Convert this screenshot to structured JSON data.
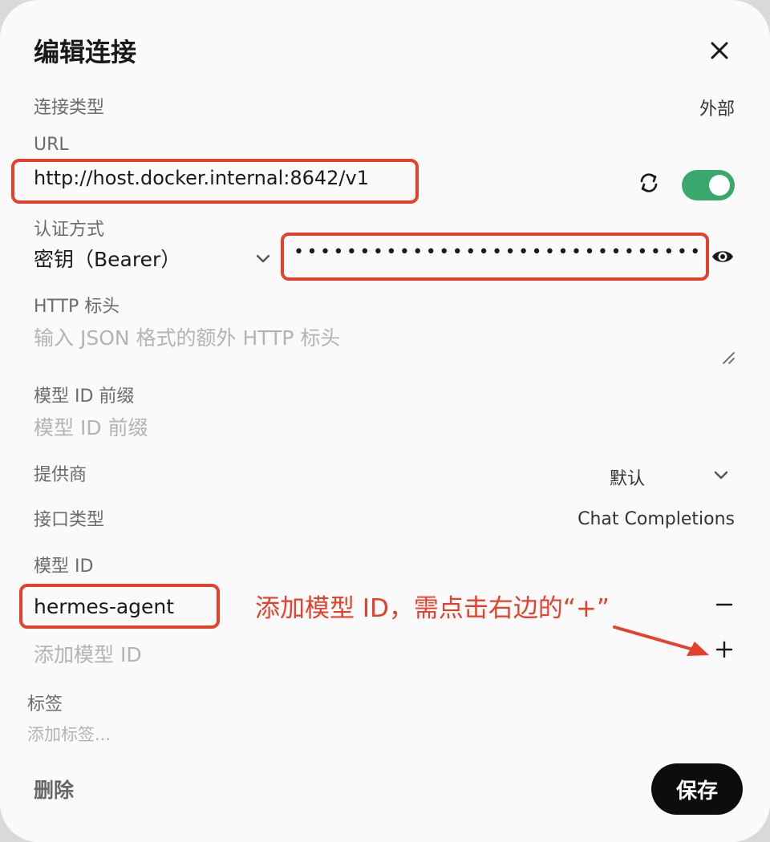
{
  "dialog": {
    "title": "编辑连接"
  },
  "connection_type": {
    "label": "连接类型",
    "value": "外部"
  },
  "url": {
    "label": "URL",
    "value": "http://host.docker.internal:8642/v1",
    "enabled": true
  },
  "auth": {
    "label": "认证方式",
    "selected": "密钥（Bearer）",
    "key_masked": "••••••••••••••••••••••••••••••••••••••"
  },
  "http_headers": {
    "label": "HTTP 标头",
    "placeholder": "输入 JSON 格式的额外 HTTP 标头"
  },
  "model_prefix": {
    "label": "模型 ID 前缀",
    "placeholder": "模型 ID 前缀"
  },
  "provider": {
    "label": "提供商",
    "selected": "默认"
  },
  "api_type": {
    "label": "接口类型",
    "value": "Chat Completions"
  },
  "model_id": {
    "label": "模型 ID",
    "items": [
      "hermes-agent"
    ],
    "add_placeholder": "添加模型 ID"
  },
  "tags": {
    "label": "标签",
    "placeholder": "添加标签..."
  },
  "annotation": {
    "text": "添加模型 ID，需点击右边的“+”",
    "color": "#e5402b"
  },
  "footer": {
    "delete_label": "删除",
    "save_label": "保存"
  },
  "colors": {
    "toggle_on": "#3aa86c",
    "highlight": "#e5402b",
    "save_bg": "#0d0d0d"
  }
}
